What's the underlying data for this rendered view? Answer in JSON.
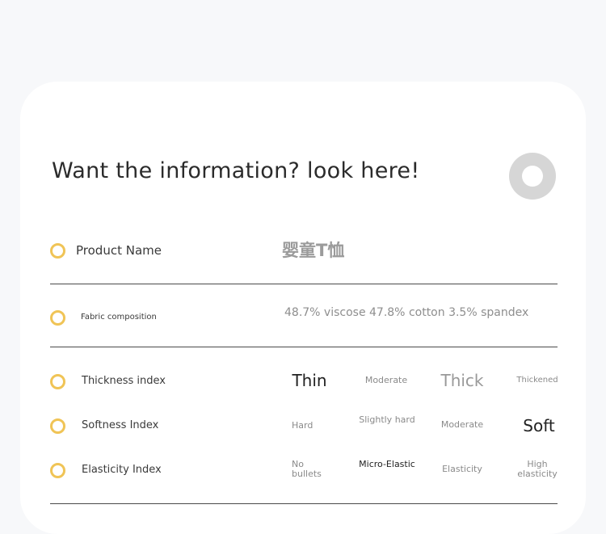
{
  "header": {
    "title": "Want the information? look here!"
  },
  "product_name": {
    "label": "Product Name",
    "value": "婴童T恤"
  },
  "fabric": {
    "label": "Fabric composition",
    "value": "48.7% viscose 47.8% cotton 3.5% spandex"
  },
  "thickness": {
    "label": "Thickness index",
    "options": [
      "Thin",
      "Moderate",
      "Thick",
      "Thickened"
    ]
  },
  "softness": {
    "label": "Softness Index",
    "options": [
      "Hard",
      "Slightly hard",
      "Moderate",
      "Soft"
    ]
  },
  "elasticity": {
    "label": "Elasticity Index",
    "options": [
      "No bullets",
      "Micro-Elastic",
      "Elasticity",
      "High elasticity"
    ]
  },
  "colors": {
    "accent_ring": "#f0c456",
    "decor_ring": "#d6d6d6"
  }
}
